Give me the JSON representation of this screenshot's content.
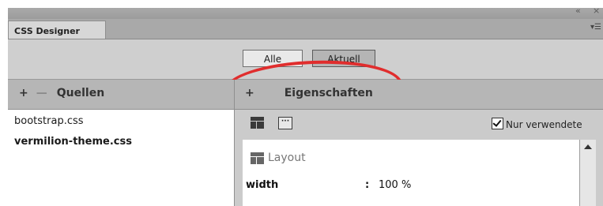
{
  "panel": {
    "tab_title": "CSS Designer",
    "menu_icon": "panel-menu-icon"
  },
  "toolbar": {
    "all_label": "Alle",
    "current_label": "Aktuell",
    "selected": "Aktuell",
    "highlight_color": "#e02d2d"
  },
  "sources": {
    "header": "Quellen",
    "add_icon": "plus-icon",
    "remove_icon": "minus-icon",
    "items": [
      {
        "label": "bootstrap.css"
      },
      {
        "label": "vermilion-theme.css"
      }
    ]
  },
  "properties": {
    "header": "Eigenschaften",
    "add_icon": "plus-icon",
    "show_set_label": "Nur verwendete",
    "show_set_checked": true,
    "section_title": "Layout",
    "rows": [
      {
        "name": "width",
        "separator": ":",
        "value": "100 %"
      }
    ]
  }
}
